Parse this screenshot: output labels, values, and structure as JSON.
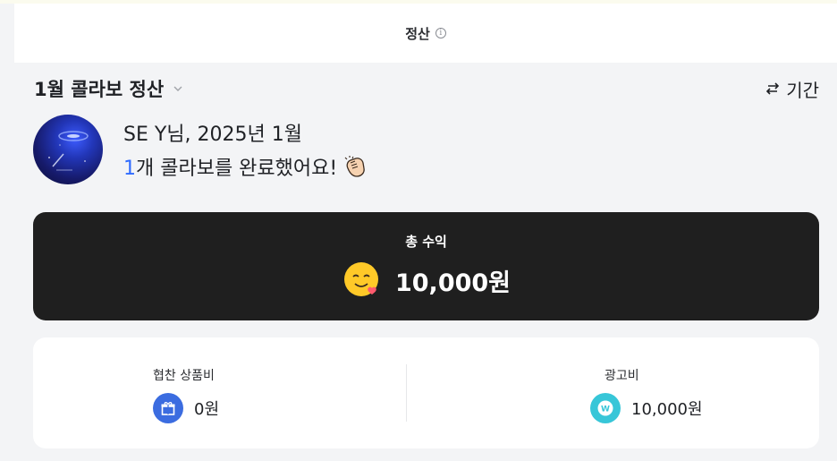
{
  "header": {
    "title": "정산",
    "info_icon": "info-icon"
  },
  "period": {
    "title": "1월 콜라보 정산",
    "toggle_label": "기간"
  },
  "profile": {
    "greeting": "SE Y님, 2025년 1월",
    "collab_count": "1",
    "collab_suffix": "개 콜라보를 완료했어요!"
  },
  "total": {
    "label": "총 수익",
    "value": "10,000원"
  },
  "details": [
    {
      "label": "협찬 상품비",
      "value": "0원",
      "icon": "gift-icon"
    },
    {
      "label": "광고비",
      "value": "10,000원",
      "icon": "won-coin-icon"
    }
  ],
  "colors": {
    "accent": "#2f6bff",
    "total_card": "#1f1f1f",
    "gift_icon_bg": "#3b6ce0",
    "won_icon_bg": "#37c6d8"
  }
}
